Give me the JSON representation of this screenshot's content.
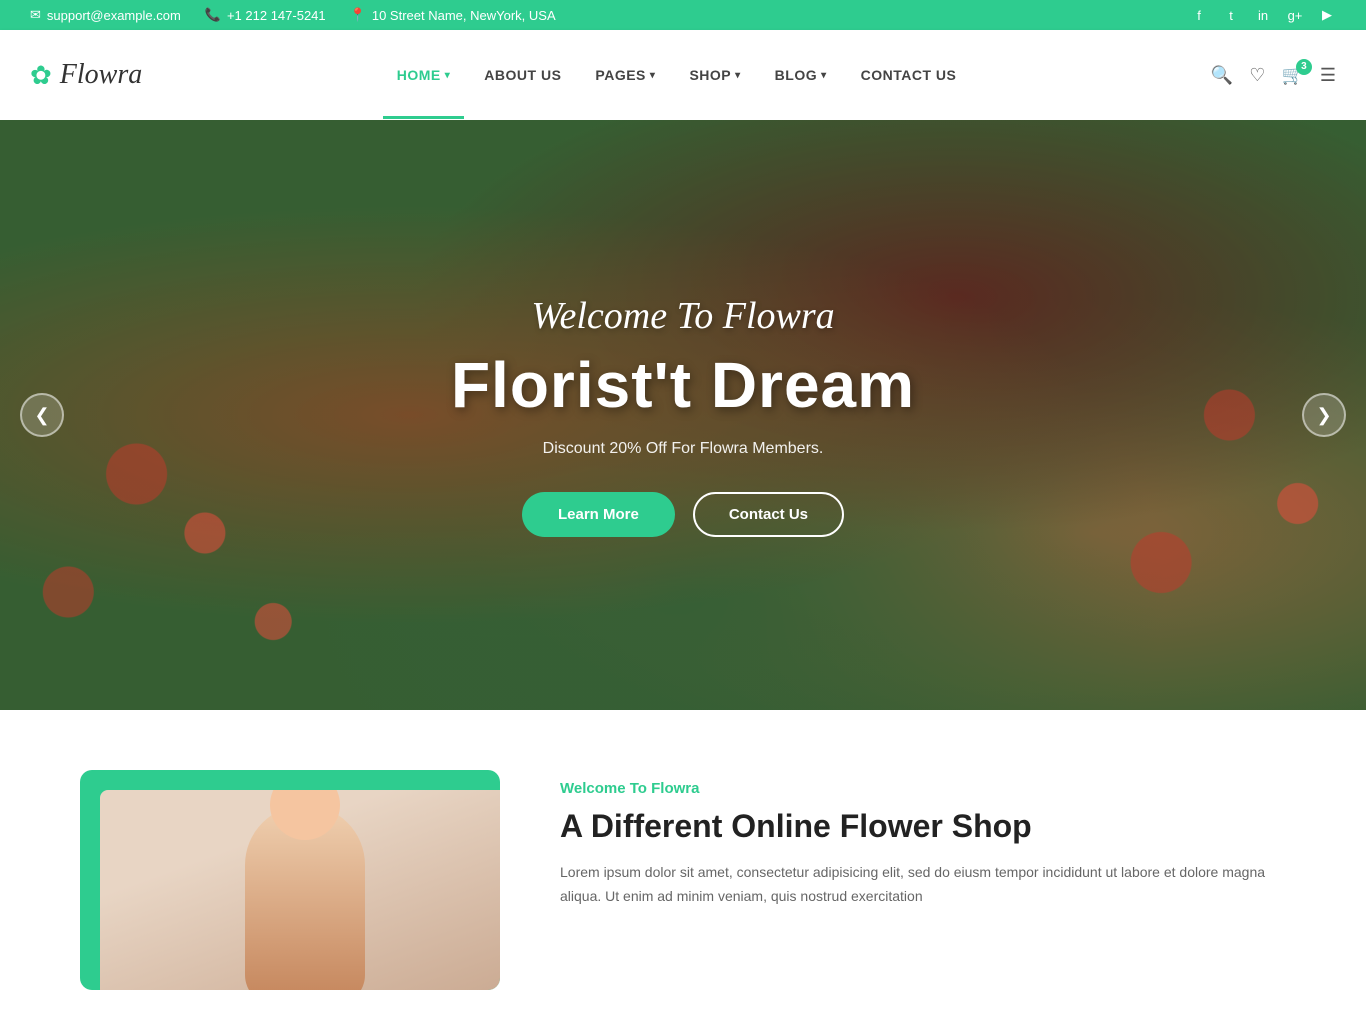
{
  "topbar": {
    "email": "support@example.com",
    "phone": "+1 212 147-5241",
    "address": "10 Street Name, NewYork, USA",
    "socials": [
      "facebook",
      "twitter",
      "instagram",
      "google-plus",
      "youtube"
    ]
  },
  "header": {
    "logo_text": "Flowra",
    "nav_items": [
      {
        "label": "HOME",
        "active": true,
        "has_dropdown": true
      },
      {
        "label": "ABOUT US",
        "active": false,
        "has_dropdown": false
      },
      {
        "label": "PAGES",
        "active": false,
        "has_dropdown": true
      },
      {
        "label": "SHOP",
        "active": false,
        "has_dropdown": true
      },
      {
        "label": "BLOG",
        "active": false,
        "has_dropdown": true
      },
      {
        "label": "CONTACT US",
        "active": false,
        "has_dropdown": false
      }
    ],
    "cart_count": "3"
  },
  "hero": {
    "subtitle": "Welcome To Flowra",
    "title": "Florist't Dream",
    "description": "Discount 20% Off For Flowra Members.",
    "btn_primary": "Learn More",
    "btn_outline": "Contact Us",
    "arrow_left": "‹",
    "arrow_right": "›"
  },
  "below_fold": {
    "tag": "Welcome To Flowra",
    "heading": "A Different Online Flower Shop",
    "paragraph": "Lorem ipsum dolor sit amet, consectetur adipisicing elit, sed do eiusm tempor incididunt ut labore et dolore magna aliqua. Ut enim ad minim veniam, quis nostrud exercitation"
  },
  "icons": {
    "email": "✉",
    "phone": "📞",
    "location": "📍",
    "search": "🔍",
    "heart": "♡",
    "cart": "🛒",
    "menu": "☰",
    "facebook": "f",
    "twitter": "t",
    "instagram": "in",
    "google_plus": "g+",
    "youtube": "▶",
    "chevron_down": "▾",
    "arrow_left": "❮",
    "arrow_right": "❯"
  },
  "colors": {
    "primary": "#2ecc8f",
    "dark": "#222222",
    "text": "#444444",
    "light_text": "#666666",
    "white": "#ffffff"
  }
}
